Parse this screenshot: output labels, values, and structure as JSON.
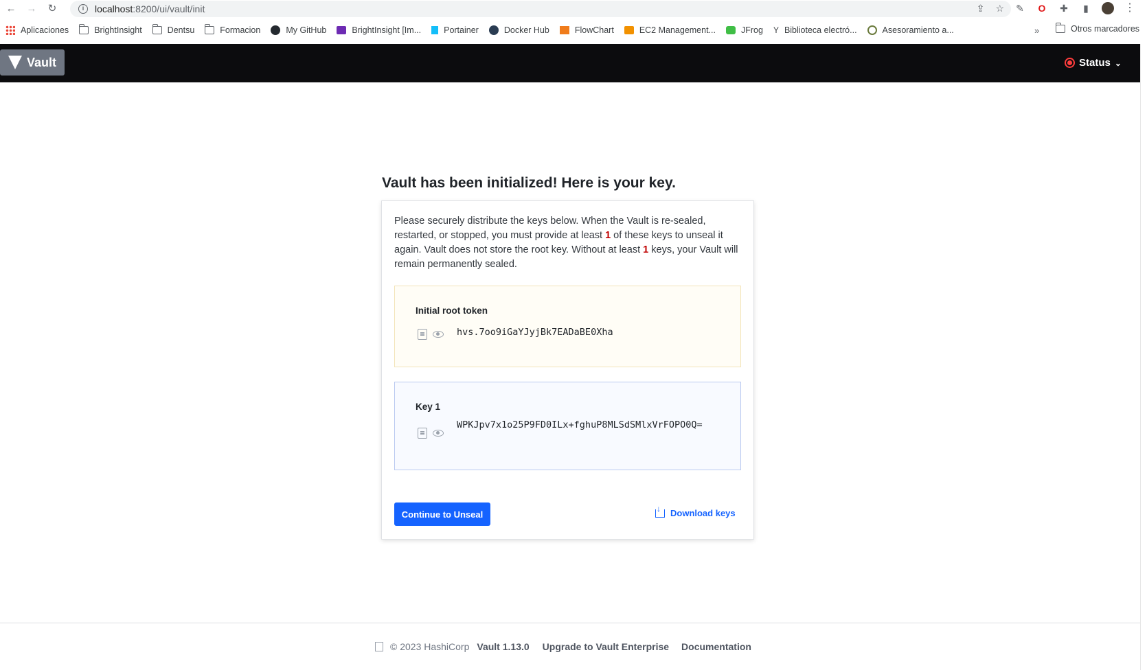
{
  "browser": {
    "url_host": "localhost",
    "url_path": ":8200/ui/vault/init",
    "bookmarks": [
      {
        "label": "Aplicaciones",
        "icon": "apps-icon"
      },
      {
        "label": "BrightInsight",
        "icon": "folder-icon"
      },
      {
        "label": "Dentsu",
        "icon": "folder-icon"
      },
      {
        "label": "Formacion",
        "icon": "folder-icon"
      },
      {
        "label": "My GitHub",
        "icon": "github-icon"
      },
      {
        "label": "BrightInsight [Im...",
        "icon": "trello-icon"
      },
      {
        "label": "Portainer",
        "icon": "portainer-icon"
      },
      {
        "label": "Docker Hub",
        "icon": "docker-icon"
      },
      {
        "label": "FlowChart",
        "icon": "flowchart-icon"
      },
      {
        "label": "EC2 Management...",
        "icon": "aws-icon"
      },
      {
        "label": "JFrog",
        "icon": "jfrog-icon"
      },
      {
        "label": "Biblioteca electró...",
        "icon": "library-icon"
      },
      {
        "label": "Asesoramiento a...",
        "icon": "gear-icon"
      }
    ],
    "more_label": "»",
    "other_bookmarks": "Otros marcadores"
  },
  "header": {
    "logo_text": "Vault",
    "status_label": "Status",
    "status_color": "#ff3d3d"
  },
  "main": {
    "title": "Vault has been initialized! Here is your key.",
    "intro_1": "Please securely distribute the keys below. When the Vault is re-sealed, restarted, or stopped, you must provide at least ",
    "threshold": "1",
    "intro_2": " of these keys to unseal it again. Vault does not store the root key. Without at least ",
    "shares": "1",
    "intro_3": " keys, your Vault will remain permanently sealed.",
    "root_token_label": "Initial root token",
    "root_token": "hvs.7oo9iGaYJyjBk7EADaBE0Xha",
    "key_label": "Key 1",
    "key_value": "WPKJpv7x1o25P9FD0ILx+fghuP8MLSdSMlxVrFOPO0Q=",
    "continue_button": "Continue to Unseal",
    "download_button": "Download keys",
    "accent_color": "#1563ff"
  },
  "footer": {
    "copyright": "© 2023 HashiCorp",
    "version": "Vault 1.13.0",
    "upgrade_link": "Upgrade to Vault Enterprise",
    "docs_link": "Documentation"
  }
}
